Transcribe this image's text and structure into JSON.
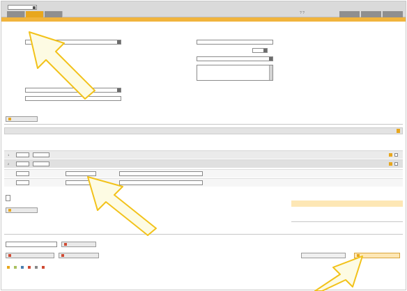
{
  "header": {
    "language_label": "",
    "language_value": "",
    "main_tabs": [
      {
        "label": "",
        "active": false
      },
      {
        "label": "",
        "active": true
      },
      {
        "label": "",
        "active": false
      }
    ],
    "help_icon": "question-icon",
    "logo_text": "",
    "right_tabs": [
      {
        "label": ""
      },
      {
        "label": ""
      },
      {
        "label": ""
      }
    ]
  },
  "subnav": {
    "items": [
      {
        "label": "",
        "active": true
      },
      {
        "label": "",
        "active": false
      }
    ]
  },
  "breadcrumb": "",
  "address_form": {
    "left_fields": [
      {
        "label": "",
        "value": "",
        "bold": true,
        "kind": "select"
      },
      {
        "label": "",
        "value": "",
        "bold": false,
        "kind": "text"
      },
      {
        "label": "",
        "value": "",
        "bold": false,
        "kind": "text"
      },
      {
        "label": "",
        "value": "",
        "bold": false,
        "kind": "text"
      },
      {
        "label": "",
        "value": "",
        "bold": false,
        "kind": "text"
      },
      {
        "label": "",
        "value": "",
        "bold": false,
        "kind": "text"
      },
      {
        "label": "",
        "value": "",
        "bold": true,
        "kind": "select"
      },
      {
        "label": "",
        "value": "",
        "bold": true,
        "kind": "input"
      }
    ],
    "right_fields": {
      "field1_label": "",
      "field2_label": "",
      "field2_value": "",
      "field3_label": "",
      "field3_value": "",
      "field4_label": ""
    },
    "required_note": "",
    "save_button": ""
  },
  "positions": {
    "title": "",
    "header_right": "",
    "columns": [
      "",
      "",
      "",
      "",
      "",
      "",
      "",
      "",
      "",
      ""
    ],
    "rows": [
      {
        "qty": "",
        "unit": "",
        "article_no": "",
        "article_sub": "",
        "description": "",
        "price": "",
        "discount": "",
        "total": ""
      },
      {
        "qty": "",
        "unit": "",
        "article_no": "",
        "article_sub": "",
        "description": "",
        "price": "",
        "discount": "",
        "total": ""
      }
    ],
    "hint_lines": [
      "",
      "",
      ""
    ],
    "voucher_label": "",
    "voucher_sub": "",
    "voucher_button": "",
    "summary": [
      {
        "key": "",
        "value": "",
        "value2": "",
        "highlight": false
      },
      {
        "key": "",
        "value": "",
        "value2": "",
        "highlight": true
      },
      {
        "key": "",
        "value": "",
        "value2": "",
        "highlight": false
      },
      {
        "key": "",
        "value": "",
        "value2": "",
        "highlight": false
      }
    ]
  },
  "footer_actions": {
    "reference_label": "",
    "add_button": "",
    "left_buttons": [
      "",
      ""
    ],
    "right_button_disabled": "",
    "submit_button": ""
  },
  "legend": [
    {
      "label": "",
      "color": "#e8a71e"
    },
    {
      "label": "",
      "color": "#a8c060"
    },
    {
      "label": "",
      "color": "#4a7fb0"
    },
    {
      "label": "",
      "color": "#cf4a33"
    },
    {
      "label": "",
      "color": "#888888"
    },
    {
      "label": "",
      "color": "#cf4a33"
    }
  ],
  "colors": {
    "accent": "#e8a71e",
    "tab_gray": "#8f8f8f",
    "highlight": "#fde7b5",
    "arrow_fill": "#fdfbe3",
    "arrow_stroke": "#f2c21a"
  }
}
